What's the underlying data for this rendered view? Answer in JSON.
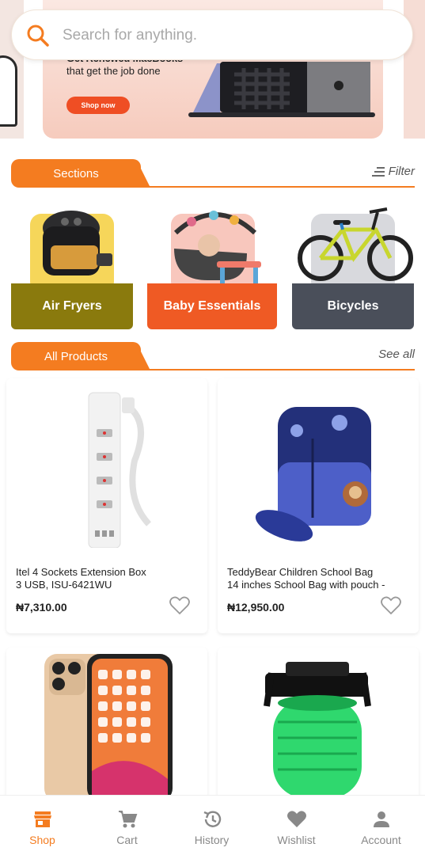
{
  "banner": {
    "heading": "Get Renewed MacBooks",
    "subtitle": "that get the job done",
    "cta_label": "Shop now"
  },
  "search": {
    "placeholder": "Search for anything."
  },
  "sections_header": {
    "tab_label": "Sections",
    "link_label": "Filter"
  },
  "categories": [
    {
      "label": "Air Fryers",
      "bar_color": "#8a7a0d"
    },
    {
      "label": "Baby Essentials",
      "bar_color": "#ef5a24"
    },
    {
      "label": "Bicycles",
      "bar_color": "#4a4f5a"
    }
  ],
  "products_header": {
    "tab_label": "All Products",
    "link_label": "See all"
  },
  "products": [
    {
      "name_line1": "Itel 4 Sockets Extension Box",
      "name_line2": "3 USB, ISU-6421WU",
      "price": "₦7,310.00"
    },
    {
      "name_line1": "TeddyBear Children School Bag",
      "name_line2": "14 inches School Bag with pouch -",
      "price": "₦12,950.00"
    }
  ],
  "nav": {
    "items": [
      {
        "label": "Shop",
        "icon": "store-icon",
        "active": true
      },
      {
        "label": "Cart",
        "icon": "cart-icon",
        "active": false
      },
      {
        "label": "History",
        "icon": "history-icon",
        "active": false
      },
      {
        "label": "Wishlist",
        "icon": "heart-icon",
        "active": false
      },
      {
        "label": "Account",
        "icon": "person-icon",
        "active": false
      }
    ]
  },
  "colors": {
    "accent": "#f47c20",
    "cta": "#ef4e24"
  }
}
